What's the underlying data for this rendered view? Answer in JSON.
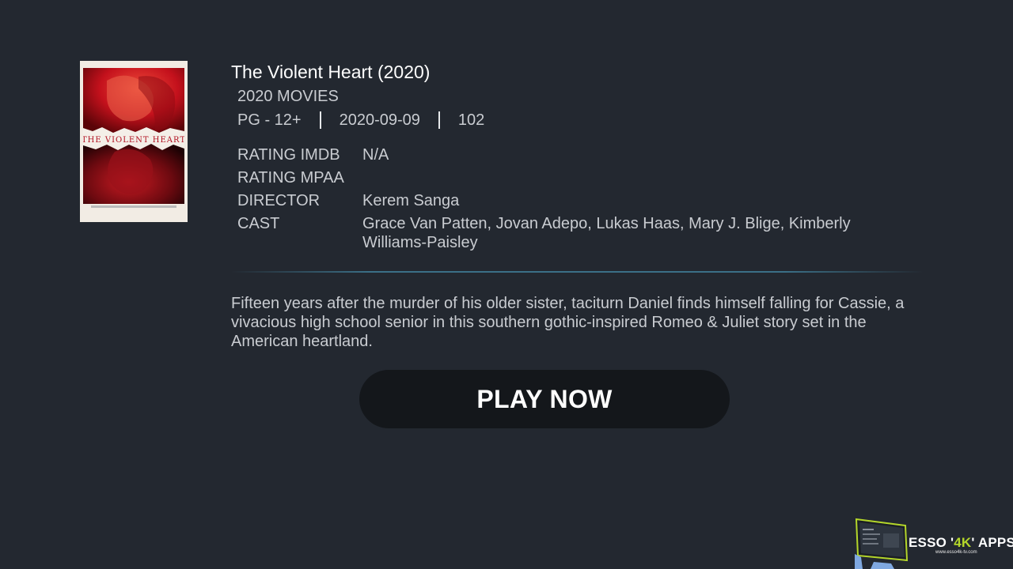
{
  "movie": {
    "title": "The Violent Heart (2020)",
    "category": "2020 MOVIES",
    "age_rating": "PG - 12+",
    "release_date": "2020-09-09",
    "duration": "102",
    "poster_title": "THE VIOLENT HEART"
  },
  "details": [
    {
      "key": "RATING IMDB",
      "value": "N/A"
    },
    {
      "key": "RATING MPAA",
      "value": ""
    },
    {
      "key": "DIRECTOR",
      "value": "Kerem Sanga"
    },
    {
      "key": "CAST",
      "value": "Grace Van Patten, Jovan Adepo, Lukas Haas, Mary J. Blige, Kimberly Williams-Paisley"
    }
  ],
  "plot": "Fifteen years after the murder of his older sister, taciturn Daniel finds himself falling for Cassie, a vivacious high school senior in this southern gothic-inspired Romeo & Juliet story set in the American heartland.",
  "play_button_label": "PLAY NOW",
  "brand": {
    "name_prefix": "ESSO '",
    "name_accent": "4K",
    "name_suffix": "' APPS",
    "url": "www.esso4k-tv.com"
  },
  "colors": {
    "background": "#232830",
    "button": "#14171b",
    "divider": "#3b6f86",
    "brand_accent": "#b4d62a"
  }
}
